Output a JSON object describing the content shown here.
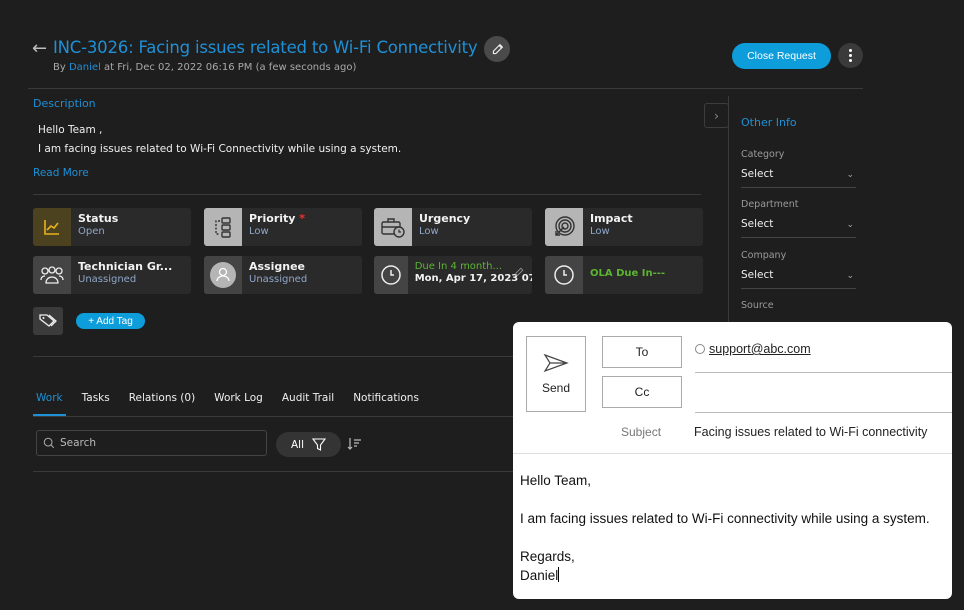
{
  "header": {
    "back_icon": "arrow-left-icon",
    "title": "INC-3026: Facing issues related to Wi-Fi Connectivity",
    "edit_icon": "pencil-icon",
    "by_prefix": "By ",
    "author": "Daniel",
    "timestamp": " at Fri, Dec 02, 2022 06:16 PM (a few seconds ago)",
    "close_button": "Close Request",
    "more_icon": "vertical-dots-icon"
  },
  "description": {
    "label": "Description",
    "line1": "Hello Team ,",
    "line2": "I am facing issues related to Wi-Fi Connectivity while using a system.",
    "read_more": "Read More"
  },
  "cards": [
    {
      "label": "Status",
      "value": "Open",
      "icon": "trend-chart-icon",
      "icon_bg": "#4d421f",
      "icon_color": "#e8b21e"
    },
    {
      "label": "Priority",
      "value": "Low",
      "required": "*",
      "icon": "flow-steps-icon",
      "icon_bg": "#b5b5b5"
    },
    {
      "label": "Urgency",
      "value": "Low",
      "icon": "briefcase-clock-icon",
      "icon_bg": "#b5b5b5"
    },
    {
      "label": "Impact",
      "value": "Low",
      "icon": "target-cursor-icon",
      "icon_bg": "#b5b5b5"
    },
    {
      "label": "Technician Gr...",
      "value": "Unassigned",
      "icon": "group-icon",
      "icon_bg": "#444444"
    },
    {
      "label": "Assignee",
      "value": "Unassigned",
      "icon": "user-avatar-icon",
      "icon_bg": "#444444"
    },
    {
      "label": "Due In 4 month...",
      "value": "Mon, Apr 17, 2023 07...",
      "icon": "clock-icon",
      "icon_bg": "#444444",
      "label_color": "#5cb531"
    },
    {
      "label": "OLA Due In---",
      "icon": "clock-icon",
      "icon_bg": "#444444",
      "label_color": "#5cb531"
    }
  ],
  "tags": {
    "icon": "tag-icon",
    "add_label": "+ Add Tag"
  },
  "tabs": [
    {
      "label": "Work",
      "active": true
    },
    {
      "label": "Tasks"
    },
    {
      "label": "Relations (0)"
    },
    {
      "label": "Work Log"
    },
    {
      "label": "Audit Trail"
    },
    {
      "label": "Notifications"
    }
  ],
  "toolbar": {
    "search_placeholder": "Search",
    "filter_label": "All",
    "filter_icon": "funnel-icon",
    "sort_icon": "sort-desc-icon"
  },
  "other_info": {
    "title": "Other Info",
    "fields": [
      {
        "label": "Category",
        "value": "Select"
      },
      {
        "label": "Department",
        "value": "Select"
      },
      {
        "label": "Company",
        "value": "Select"
      },
      {
        "label": "Source"
      }
    ]
  },
  "email": {
    "send_label": "Send",
    "to_label": "To",
    "cc_label": "Cc",
    "to_address": "support@abc.com",
    "subject_label": "Subject",
    "subject": "Facing issues related to Wi-Fi connectivity",
    "body": [
      "Hello Team,",
      "",
      "I am facing issues related to Wi-Fi connectivity while using a system.",
      "",
      "Regards,",
      "Daniel"
    ]
  },
  "colors": {
    "accent": "#1e90d6",
    "button": "#0d9ddb",
    "success": "#5cb531",
    "background": "#1e1e1e"
  }
}
